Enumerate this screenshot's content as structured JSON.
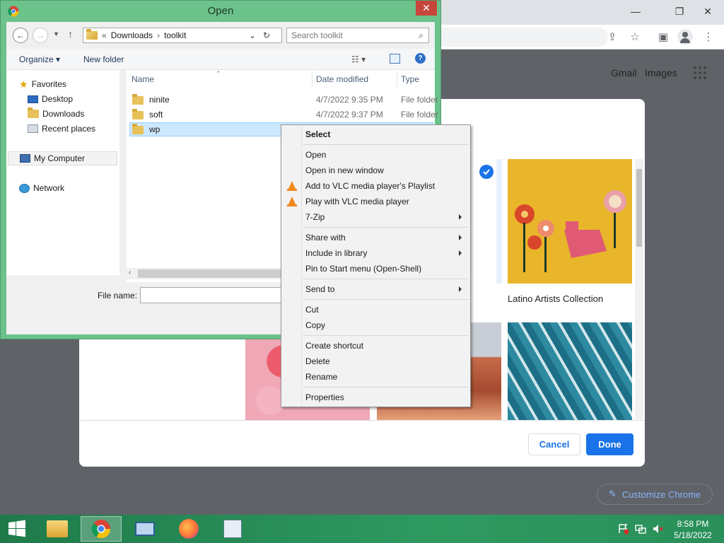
{
  "open_dialog": {
    "title": "Open",
    "address": {
      "sep": "«",
      "path": [
        "Downloads",
        "toolkit"
      ]
    },
    "search_placeholder": "Search toolkit",
    "toolbar": {
      "organize": "Organize ▾",
      "new_folder": "New folder"
    },
    "nav": {
      "favorites": "Favorites",
      "desktop": "Desktop",
      "downloads": "Downloads",
      "recent": "Recent places",
      "computer": "My Computer",
      "network": "Network"
    },
    "columns": {
      "name": "Name",
      "date": "Date modified",
      "type": "Type"
    },
    "files": [
      {
        "name": "ninite",
        "date": "4/7/2022 9:35 PM",
        "type": "File folder"
      },
      {
        "name": "soft",
        "date": "4/7/2022 9:37 PM",
        "type": "File folder"
      },
      {
        "name": "wp",
        "date": "",
        "type": ""
      }
    ],
    "file_name_label": "File name:"
  },
  "context_menu": {
    "items": [
      {
        "label": "Select",
        "bold": true
      },
      {
        "label": "Open"
      },
      {
        "label": "Open in new window"
      },
      {
        "label": "Add to VLC media player's Playlist"
      },
      {
        "label": "Play with VLC media player"
      },
      {
        "label": "7-Zip"
      },
      {
        "label": "Share with"
      },
      {
        "label": "Include in library"
      },
      {
        "label": "Pin to Start menu (Open-Shell)"
      },
      {
        "label": "Send to"
      },
      {
        "label": "Cut"
      },
      {
        "label": "Copy"
      },
      {
        "label": "Create shortcut"
      },
      {
        "label": "Delete"
      },
      {
        "label": "Rename"
      },
      {
        "label": "Properties"
      }
    ]
  },
  "chrome": {
    "gmail": "Gmail",
    "images": "Images",
    "collection_label": "Latino Artists Collection",
    "cancel": "Cancel",
    "done": "Done",
    "customize": "Customize Chrome"
  },
  "taskbar": {
    "time": "8:58 PM",
    "date": "5/18/2022"
  },
  "colors": {
    "accent": "#1a73e8",
    "taskbar": "#2e9a60",
    "dialog_frame": "#6bc28a"
  }
}
